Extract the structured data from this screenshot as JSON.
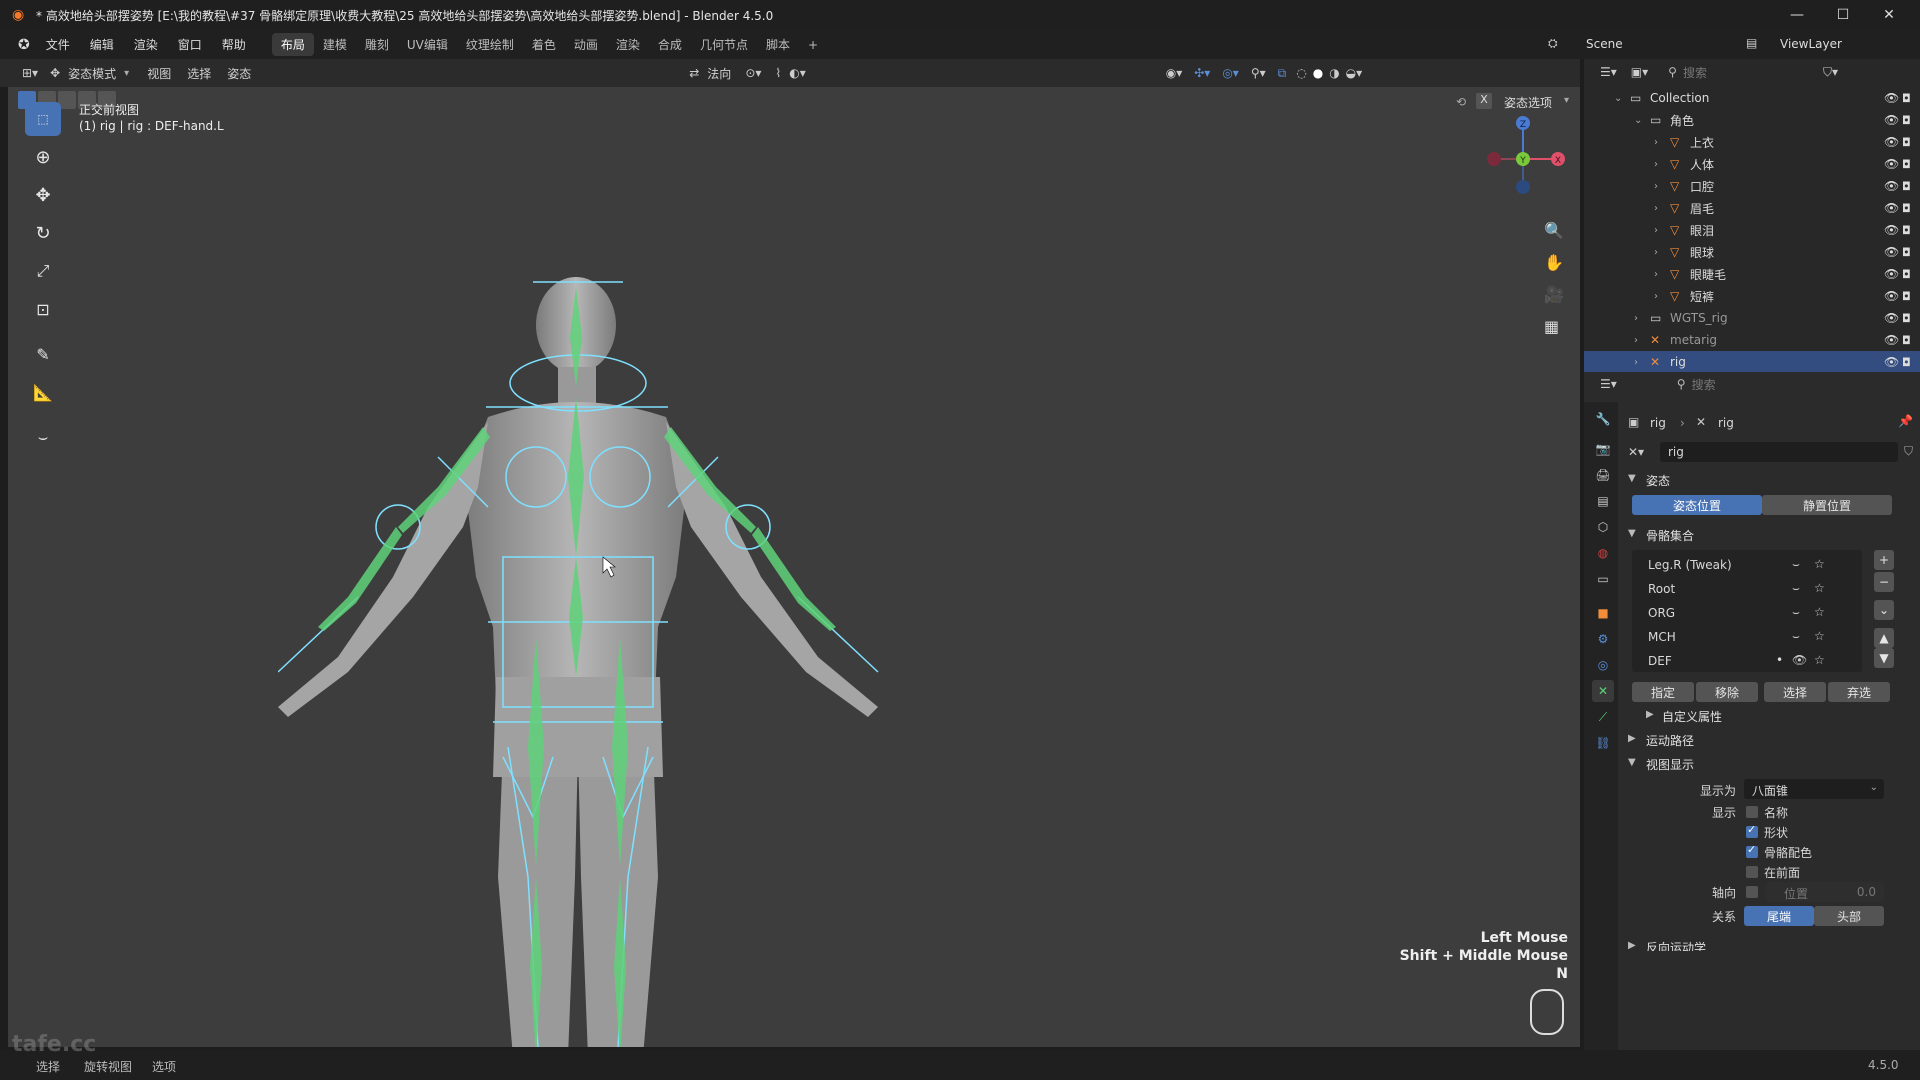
{
  "window": {
    "title": "* 高效地给头部摆姿势 [E:\\我的教程\\#37 骨骼绑定原理\\收费大教程\\25 高效地给头部摆姿势\\高效地给头部摆姿势.blend] - Blender 4.5.0",
    "minimize": "—",
    "maximize": "☐",
    "close": "✕"
  },
  "menu": [
    "文件",
    "编辑",
    "渲染",
    "窗口",
    "帮助"
  ],
  "workspaces": [
    "布局",
    "建模",
    "雕刻",
    "UV编辑",
    "纹理绘制",
    "着色",
    "动画",
    "渲染",
    "合成",
    "几何节点",
    "脚本"
  ],
  "workspace_add": "+",
  "scene": {
    "label": "Scene",
    "view_layer": "ViewLayer"
  },
  "header": {
    "mode": "姿态模式",
    "menus": [
      "视图",
      "选择",
      "姿态"
    ],
    "orientation": "法向",
    "pose_options": "姿态选项"
  },
  "viewport": {
    "view_name": "正交前视图",
    "active_info": "(1) rig | rig : DEF-hand.L",
    "keys": [
      "Left Mouse",
      "Shift + Middle Mouse",
      "N"
    ],
    "gizmo": {
      "z": "Z",
      "y": "Y",
      "x": "X"
    }
  },
  "outliner": {
    "search_placeholder": "搜索",
    "items": [
      {
        "label": "Collection",
        "depth": 0
      },
      {
        "label": "角色",
        "depth": 1
      },
      {
        "label": "上衣",
        "depth": 2
      },
      {
        "label": "人体",
        "depth": 2
      },
      {
        "label": "口腔",
        "depth": 2
      },
      {
        "label": "眉毛",
        "depth": 2
      },
      {
        "label": "眼泪",
        "depth": 2
      },
      {
        "label": "眼球",
        "depth": 2
      },
      {
        "label": "眼睫毛",
        "depth": 2
      },
      {
        "label": "短裤",
        "depth": 2
      },
      {
        "label": "WGTS_rig",
        "depth": 1
      },
      {
        "label": "metarig",
        "depth": 1
      },
      {
        "label": "rig",
        "depth": 1
      }
    ]
  },
  "properties": {
    "search_placeholder": "搜索",
    "breadcrumb": [
      "rig",
      "rig"
    ],
    "datablock_name": "rig",
    "pose_section": "姿态",
    "pose_position": "姿态位置",
    "rest_position": "静置位置",
    "bone_collections_section": "骨骼集合",
    "bone_collections": [
      "Leg.R (Tweak)",
      "Root",
      "ORG",
      "MCH",
      "DEF"
    ],
    "collection_buttons": [
      "指定",
      "移除",
      "选择",
      "弃选"
    ],
    "custom_props": "自定义属性",
    "motion_paths": "运动路径",
    "viewport_display": "视图显示",
    "display_as_label": "显示为",
    "display_as_value": "八面锥",
    "show_label": "显示",
    "show_options": [
      {
        "label": "名称",
        "checked": false
      },
      {
        "label": "形状",
        "checked": true
      },
      {
        "label": "骨骼配色",
        "checked": true
      },
      {
        "label": "在前面",
        "checked": false
      }
    ],
    "axes_label": "轴向",
    "axes_position": "位置",
    "axes_value": "0.0",
    "relation_label": "关系",
    "relation_tail": "尾端",
    "relation_head": "头部",
    "next_section": "反向运动学",
    "version": "4.5.0"
  },
  "statusbar": {
    "items": [
      "选择",
      "旋转视图",
      "选项"
    ],
    "watermark": "tafe.cc"
  },
  "colors": {
    "accent": "#4772b3",
    "bone": "#7fe0ff",
    "bone_green": "#5fd27a"
  }
}
